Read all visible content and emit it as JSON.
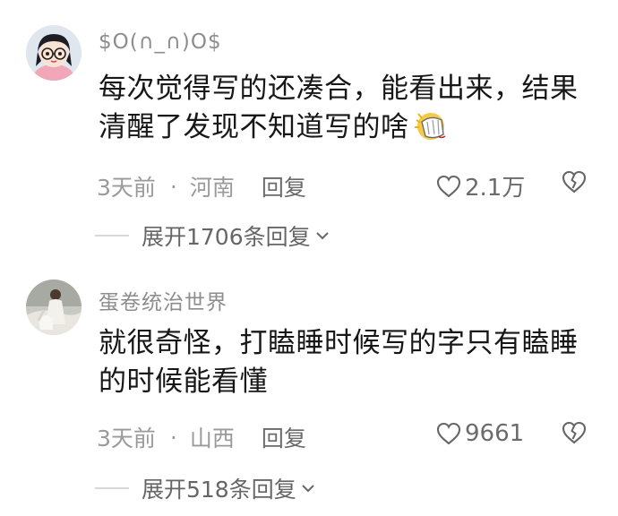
{
  "comments": [
    {
      "username": "$O(∩_∩)O$",
      "text": "每次觉得写的还凑合，能看出来，结果清醒了发现不知道写的啥",
      "time": "3天前",
      "location": "河南",
      "reply_label": "回复",
      "likes": "2.1万",
      "expand_label": "展开1706条回复",
      "emoji": "facepalm-emoji"
    },
    {
      "username": "蛋卷统治世界",
      "text": "就很奇怪，打瞌睡时候写的字只有瞌睡的时候能看懂",
      "time": "3天前",
      "location": "山西",
      "reply_label": "回复",
      "likes": "9661",
      "expand_label": "展开518条回复"
    }
  ],
  "separator": "·",
  "icons": [
    "heart-outline-icon",
    "broken-heart-icon",
    "chevron-down-icon"
  ],
  "colors": {
    "username": "#8d8d8d",
    "meta": "#9a9a9a",
    "text": "#171717"
  }
}
